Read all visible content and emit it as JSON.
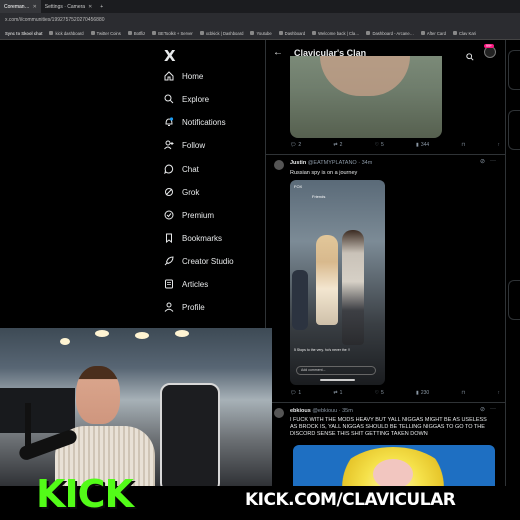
{
  "browser": {
    "tabs": [
      {
        "label": "Coreman…",
        "active": true
      },
      {
        "label": "Settings · Camera",
        "active": false
      }
    ],
    "url": "x.com/i/communities/1992757520270456880",
    "bookmarks": [
      "Sync to Skool chat",
      "kick dashboard",
      "Twitter Coins",
      "Botfliz",
      "BEToolkit + Server",
      "xcbkick | Dashboard",
      "Youtube",
      "Dashboard",
      "Welcome back | Cla…",
      "Dashboard - Arcane…",
      "After Card",
      "Clav Kari"
    ]
  },
  "sidebar": {
    "logo": "X",
    "items": [
      {
        "label": "Home",
        "icon": "home-icon"
      },
      {
        "label": "Explore",
        "icon": "search-icon"
      },
      {
        "label": "Notifications",
        "icon": "bell-icon"
      },
      {
        "label": "Follow",
        "icon": "follow-icon"
      },
      {
        "label": "Chat",
        "icon": "chat-icon"
      },
      {
        "label": "Grok",
        "icon": "grok-icon"
      },
      {
        "label": "Premium",
        "icon": "premium-icon"
      },
      {
        "label": "Bookmarks",
        "icon": "bookmark-icon"
      },
      {
        "label": "Creator Studio",
        "icon": "rocket-icon"
      },
      {
        "label": "Articles",
        "icon": "articles-icon"
      },
      {
        "label": "Profile",
        "icon": "profile-icon"
      }
    ]
  },
  "header": {
    "title": "Clavicular's Clan",
    "badge": "99+"
  },
  "posts": [
    {
      "actions": {
        "replies": "2",
        "reposts": "2",
        "likes": "5",
        "views": "344"
      }
    },
    {
      "author": "Justin",
      "handle": "@EATMYPLATANO",
      "time": "34m",
      "text": "Russian spy is on a journey",
      "video": {
        "header": "FOX",
        "tab": "Friends",
        "caption": "5 Stops to the very. ho's never the !!",
        "comment_placeholder": "Add comment..."
      },
      "actions": {
        "replies": "1",
        "reposts": "1",
        "likes": "5",
        "views": "230"
      }
    },
    {
      "author": "ebkious",
      "handle": "@ebkiouu",
      "time": "35m",
      "text": "I FUCK WITH THE MODS HEAVY BUT YALL NIGGAS MIGHT BE AS USELESS AS BROCK IS, YALL NIGGAS SHOULD BE TELLING NIGGAS TO GO TO THE DISCORD SENSE THIS SHIT GETTING TAKEN DOWN"
    }
  ],
  "overlay": {
    "kick_logo": "KICK",
    "kick_url": "KICK.COM/CLAVICULAR",
    "accent": "#53fc18"
  }
}
